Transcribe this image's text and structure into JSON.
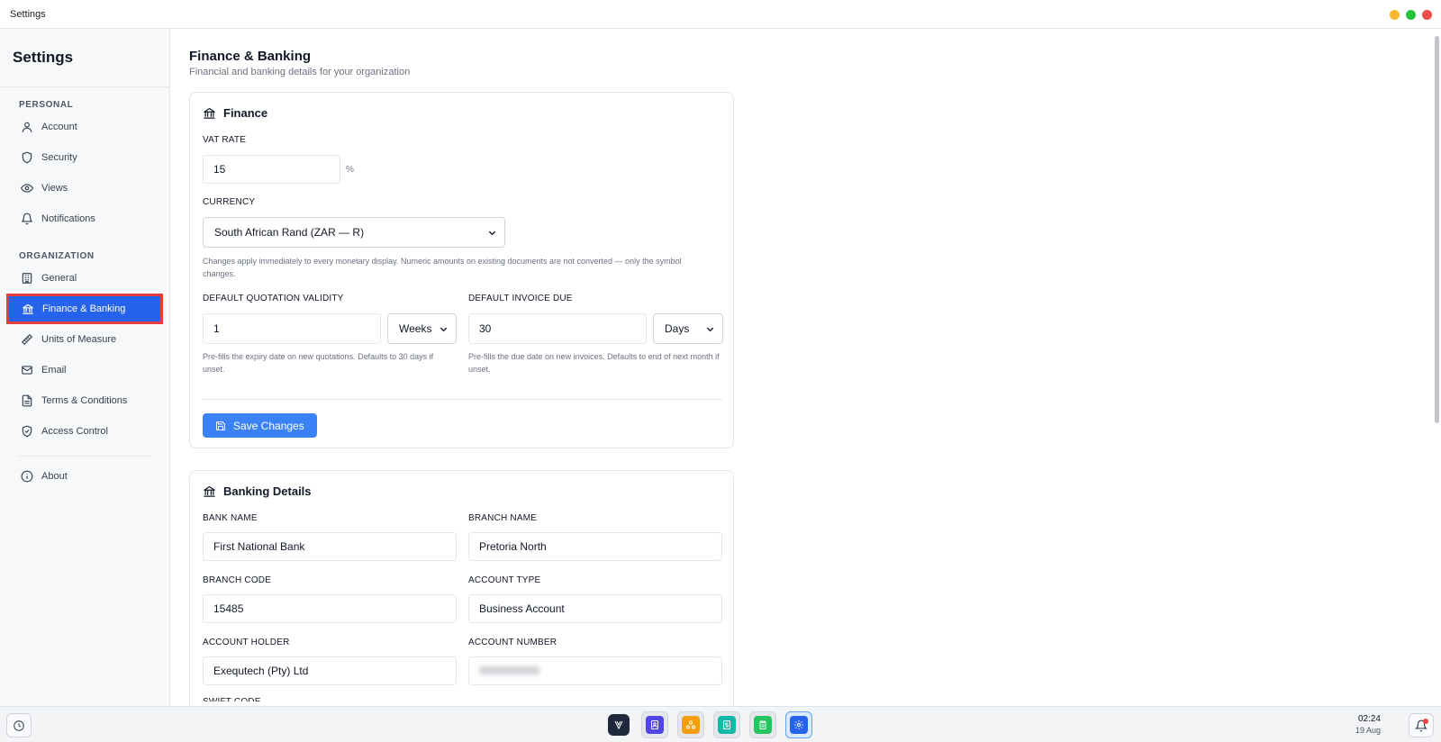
{
  "window": {
    "title": "Settings",
    "controls": {
      "minimize_color": "#f5b82e",
      "maximize_color": "#27c23b",
      "close_color": "#f04b4b"
    }
  },
  "sidebar": {
    "title": "Settings",
    "personal_label": "PERSONAL",
    "personal_items": [
      {
        "label": "Account",
        "icon": "user-icon"
      },
      {
        "label": "Security",
        "icon": "shield-icon"
      },
      {
        "label": "Views",
        "icon": "eye-icon"
      },
      {
        "label": "Notifications",
        "icon": "bell-icon"
      }
    ],
    "organization_label": "ORGANIZATION",
    "organization_items": [
      {
        "label": "General",
        "icon": "building-icon"
      },
      {
        "label": "Finance & Banking",
        "icon": "bank-icon",
        "active": true
      },
      {
        "label": "Units of Measure",
        "icon": "ruler-icon"
      },
      {
        "label": "Email",
        "icon": "mail-icon"
      },
      {
        "label": "Terms & Conditions",
        "icon": "document-icon"
      },
      {
        "label": "Access Control",
        "icon": "shield-check-icon"
      }
    ],
    "footer_items": [
      {
        "label": "About",
        "icon": "info-icon"
      }
    ]
  },
  "page": {
    "title": "Finance & Banking",
    "subtitle": "Financial and banking details for your organization"
  },
  "finance": {
    "title": "Finance",
    "vat_label": "VAT RATE",
    "vat_value": "15",
    "vat_unit": "%",
    "currency_label": "CURRENCY",
    "currency_value": "South African Rand (ZAR — R)",
    "currency_help": "Changes apply immediately to every monetary display. Numeric amounts on existing documents are not converted — only the symbol changes.",
    "quote_validity_label": "DEFAULT QUOTATION VALIDITY",
    "quote_validity_value": "1",
    "quote_validity_unit": "Weeks",
    "quote_validity_help": "Pre-fills the expiry date on new quotations. Defaults to 30 days if unset.",
    "invoice_due_label": "DEFAULT INVOICE DUE",
    "invoice_due_value": "30",
    "invoice_due_unit": "Days",
    "invoice_due_help": "Pre-fills the due date on new invoices. Defaults to end of next month if unset.",
    "save_label": "Save Changes"
  },
  "banking": {
    "title": "Banking Details",
    "bank_name_label": "BANK NAME",
    "bank_name_value": "First National Bank",
    "branch_name_label": "BRANCH NAME",
    "branch_name_value": "Pretoria North",
    "branch_code_label": "BRANCH CODE",
    "branch_code_value": "15485",
    "account_type_label": "ACCOUNT TYPE",
    "account_type_value": "Business Account",
    "account_holder_label": "ACCOUNT HOLDER",
    "account_holder_value": "Exequtech (Pty) Ltd",
    "account_number_label": "ACCOUNT NUMBER",
    "account_number_value": "0000000000",
    "swift_label": "SWIFT CODE"
  },
  "taskbar": {
    "time": "02:24",
    "date": "19 Aug",
    "apps": [
      {
        "name": "logo-app",
        "color": "#1e293b"
      },
      {
        "name": "contacts-app",
        "color": "#4f46e5"
      },
      {
        "name": "hub-app",
        "color": "#f59e0b"
      },
      {
        "name": "sales-app",
        "color": "#14b8a6"
      },
      {
        "name": "tasks-app",
        "color": "#22c55e"
      },
      {
        "name": "settings-app",
        "color": "#2563eb"
      }
    ]
  }
}
